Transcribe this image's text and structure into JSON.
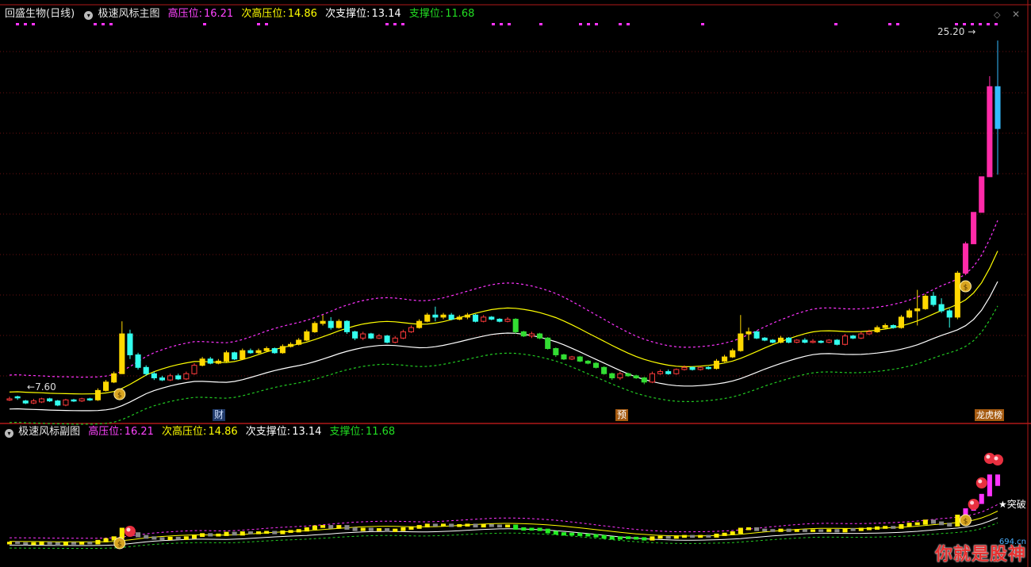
{
  "main_header": {
    "stock_name": "回盛生物(日线)",
    "indicator_name": "极速风标主图",
    "items": [
      {
        "label": "高压位:",
        "value": "16.21",
        "color": "#ff44ff"
      },
      {
        "label": "次高压位:",
        "value": "14.86",
        "color": "#ffff00"
      },
      {
        "label": "次支撑位:",
        "value": "13.14",
        "color": "#ffffff"
      },
      {
        "label": "支撑位:",
        "value": "11.68",
        "color": "#22dd22"
      }
    ]
  },
  "sub_header": {
    "indicator_name": "极速风标副图",
    "items": [
      {
        "label": "高压位:",
        "value": "16.21",
        "color": "#ff44ff"
      },
      {
        "label": "次高压位:",
        "value": "14.86",
        "color": "#ffff00"
      },
      {
        "label": "次支撑位:",
        "value": "13.14",
        "color": "#ffffff"
      },
      {
        "label": "支撑位:",
        "value": "11.68",
        "color": "#22dd22"
      }
    ]
  },
  "annotations": {
    "high_label": "25.20",
    "low_label": "7.60",
    "event_cai": "财",
    "event_yu": "预",
    "event_longhu": "龙虎榜",
    "breakout": "★突破"
  },
  "watermark": {
    "text": "你就是股神",
    "site": "694.cn"
  },
  "chart_data": {
    "type": "candlestick",
    "price_range": [
      7.0,
      26.0
    ],
    "candles": [
      [
        8.05,
        8.1,
        8.0,
        8.2
      ],
      [
        8.2,
        8.15,
        8.05,
        8.25
      ],
      [
        8.0,
        7.9,
        7.85,
        8.05
      ],
      [
        7.9,
        8.0,
        7.85,
        8.1
      ],
      [
        7.95,
        8.1,
        7.9,
        8.15
      ],
      [
        8.1,
        8.0,
        7.95,
        8.15
      ],
      [
        8.0,
        7.8,
        7.75,
        8.05
      ],
      [
        7.8,
        8.05,
        7.75,
        8.1
      ],
      [
        8.05,
        8.0,
        7.95,
        8.1
      ],
      [
        8.0,
        8.1,
        7.95,
        8.15
      ],
      [
        8.1,
        8.05,
        8.0,
        8.15
      ],
      [
        8.05,
        8.5,
        8.0,
        8.6
      ],
      [
        8.5,
        8.9,
        8.45,
        9.0
      ],
      [
        8.9,
        9.3,
        8.85,
        9.4
      ],
      [
        9.3,
        11.2,
        9.3,
        11.8
      ],
      [
        11.2,
        10.2,
        10.0,
        11.4
      ],
      [
        10.2,
        9.6,
        9.5,
        10.3
      ],
      [
        9.6,
        9.3,
        9.2,
        9.7
      ],
      [
        9.3,
        9.1,
        9.0,
        9.4
      ],
      [
        9.1,
        9.0,
        8.95,
        9.2
      ],
      [
        9.0,
        9.2,
        8.95,
        9.3
      ],
      [
        9.2,
        9.05,
        9.0,
        9.3
      ],
      [
        9.05,
        9.3,
        9.0,
        9.4
      ],
      [
        9.3,
        9.7,
        9.25,
        9.8
      ],
      [
        9.7,
        10.0,
        9.65,
        10.1
      ],
      [
        10.0,
        9.8,
        9.75,
        10.1
      ],
      [
        9.8,
        9.9,
        9.75,
        10.0
      ],
      [
        9.9,
        10.3,
        9.85,
        10.4
      ],
      [
        10.3,
        10.0,
        9.95,
        10.35
      ],
      [
        10.0,
        10.4,
        9.95,
        10.5
      ],
      [
        10.4,
        10.3,
        10.25,
        10.5
      ],
      [
        10.3,
        10.4,
        10.25,
        10.5
      ],
      [
        10.4,
        10.5,
        10.35,
        10.6
      ],
      [
        10.5,
        10.3,
        10.25,
        10.55
      ],
      [
        10.3,
        10.6,
        10.25,
        10.7
      ],
      [
        10.6,
        10.7,
        10.55,
        10.8
      ],
      [
        10.7,
        10.9,
        10.65,
        11.0
      ],
      [
        10.9,
        11.3,
        10.85,
        11.4
      ],
      [
        11.3,
        11.7,
        11.25,
        11.8
      ],
      [
        11.7,
        11.8,
        11.6,
        12.1
      ],
      [
        11.8,
        11.5,
        11.4,
        12.0
      ],
      [
        11.5,
        11.8,
        11.45,
        11.9
      ],
      [
        11.8,
        11.3,
        11.2,
        11.85
      ],
      [
        11.3,
        11.0,
        10.9,
        11.35
      ],
      [
        11.0,
        11.2,
        10.9,
        11.3
      ],
      [
        11.2,
        11.0,
        10.95,
        11.25
      ],
      [
        11.0,
        11.1,
        10.95,
        11.2
      ],
      [
        11.1,
        10.8,
        10.75,
        11.15
      ],
      [
        10.8,
        11.0,
        10.75,
        11.1
      ],
      [
        11.0,
        11.3,
        10.95,
        11.4
      ],
      [
        11.3,
        11.5,
        11.25,
        11.6
      ],
      [
        11.5,
        11.8,
        11.45,
        11.9
      ],
      [
        11.8,
        12.1,
        11.75,
        12.2
      ],
      [
        12.1,
        12.0,
        11.8,
        12.5
      ],
      [
        12.0,
        12.1,
        11.9,
        12.2
      ],
      [
        12.1,
        11.9,
        11.85,
        12.2
      ],
      [
        11.9,
        12.0,
        11.85,
        12.1
      ],
      [
        12.0,
        12.1,
        11.9,
        12.2
      ],
      [
        12.1,
        11.8,
        11.75,
        12.15
      ],
      [
        11.8,
        12.0,
        11.75,
        12.1
      ],
      [
        12.0,
        11.9,
        11.85,
        12.05
      ],
      [
        11.9,
        11.8,
        11.75,
        11.95
      ],
      [
        11.8,
        11.9,
        11.75,
        12.0
      ],
      [
        11.9,
        11.3,
        11.2,
        11.95
      ],
      [
        11.3,
        11.1,
        11.05,
        11.35
      ],
      [
        11.1,
        11.2,
        11.0,
        11.3
      ],
      [
        11.2,
        11.0,
        10.95,
        11.25
      ],
      [
        11.0,
        10.5,
        10.45,
        11.05
      ],
      [
        10.5,
        10.2,
        10.1,
        10.55
      ],
      [
        10.2,
        10.0,
        9.95,
        10.25
      ],
      [
        10.0,
        10.1,
        9.95,
        10.15
      ],
      [
        10.1,
        9.9,
        9.85,
        10.15
      ],
      [
        9.9,
        9.8,
        9.75,
        9.95
      ],
      [
        9.8,
        9.6,
        9.55,
        9.85
      ],
      [
        9.6,
        9.3,
        9.25,
        9.65
      ],
      [
        9.3,
        9.1,
        9.0,
        9.35
      ],
      [
        9.1,
        9.3,
        9.0,
        9.4
      ],
      [
        9.3,
        9.2,
        9.15,
        9.35
      ],
      [
        9.2,
        9.1,
        9.05,
        9.25
      ],
      [
        9.1,
        8.9,
        8.8,
        9.15
      ],
      [
        8.9,
        9.3,
        8.85,
        9.4
      ],
      [
        9.3,
        9.4,
        9.25,
        9.5
      ],
      [
        9.4,
        9.3,
        9.25,
        9.5
      ],
      [
        9.3,
        9.5,
        9.25,
        9.55
      ],
      [
        9.5,
        9.6,
        9.45,
        9.7
      ],
      [
        9.6,
        9.5,
        9.45,
        9.65
      ],
      [
        9.5,
        9.6,
        9.45,
        9.65
      ],
      [
        9.6,
        9.55,
        9.5,
        9.65
      ],
      [
        9.55,
        9.9,
        9.5,
        10.0
      ],
      [
        9.9,
        10.1,
        9.85,
        10.2
      ],
      [
        10.1,
        10.4,
        10.05,
        10.5
      ],
      [
        10.4,
        11.2,
        10.35,
        12.1
      ],
      [
        11.2,
        11.3,
        10.9,
        11.5
      ],
      [
        11.3,
        11.0,
        10.95,
        11.35
      ],
      [
        11.0,
        10.9,
        10.85,
        11.05
      ],
      [
        10.9,
        10.8,
        10.75,
        10.95
      ],
      [
        10.8,
        11.0,
        10.75,
        11.1
      ],
      [
        11.0,
        10.8,
        10.75,
        11.05
      ],
      [
        10.8,
        10.9,
        10.75,
        10.95
      ],
      [
        10.9,
        10.8,
        10.75,
        11.0
      ],
      [
        10.8,
        10.85,
        10.75,
        10.95
      ],
      [
        10.85,
        10.8,
        10.75,
        10.9
      ],
      [
        10.8,
        10.9,
        10.75,
        10.95
      ],
      [
        10.9,
        10.7,
        10.65,
        10.95
      ],
      [
        10.7,
        11.1,
        10.65,
        11.2
      ],
      [
        11.1,
        11.0,
        10.95,
        11.15
      ],
      [
        11.0,
        11.2,
        10.95,
        11.3
      ],
      [
        11.2,
        11.3,
        11.15,
        11.4
      ],
      [
        11.3,
        11.5,
        11.25,
        11.6
      ],
      [
        11.5,
        11.6,
        11.45,
        11.7
      ],
      [
        11.6,
        11.5,
        11.45,
        11.65
      ],
      [
        11.5,
        12.0,
        11.45,
        12.1
      ],
      [
        12.0,
        12.3,
        11.95,
        12.4
      ],
      [
        12.3,
        12.4,
        11.6,
        13.3
      ],
      [
        12.4,
        13.0,
        12.35,
        13.1
      ],
      [
        13.0,
        12.6,
        12.5,
        13.2
      ],
      [
        12.6,
        12.3,
        12.2,
        12.9
      ],
      [
        12.3,
        12.0,
        11.5,
        12.4
      ],
      [
        12.0,
        14.1,
        11.9,
        14.2
      ],
      [
        14.1,
        15.5,
        14.0,
        15.6
      ],
      [
        15.5,
        17.0,
        16.8,
        17.0
      ],
      [
        17.0,
        18.7,
        18.5,
        18.7
      ],
      [
        18.7,
        23.0,
        22.0,
        23.5
      ],
      [
        23.0,
        21.0,
        18.8,
        25.2
      ]
    ],
    "bands": {
      "upper_dashed": "magenta",
      "yellow": "yellow",
      "white": "white",
      "lower_dashed": "green"
    }
  }
}
